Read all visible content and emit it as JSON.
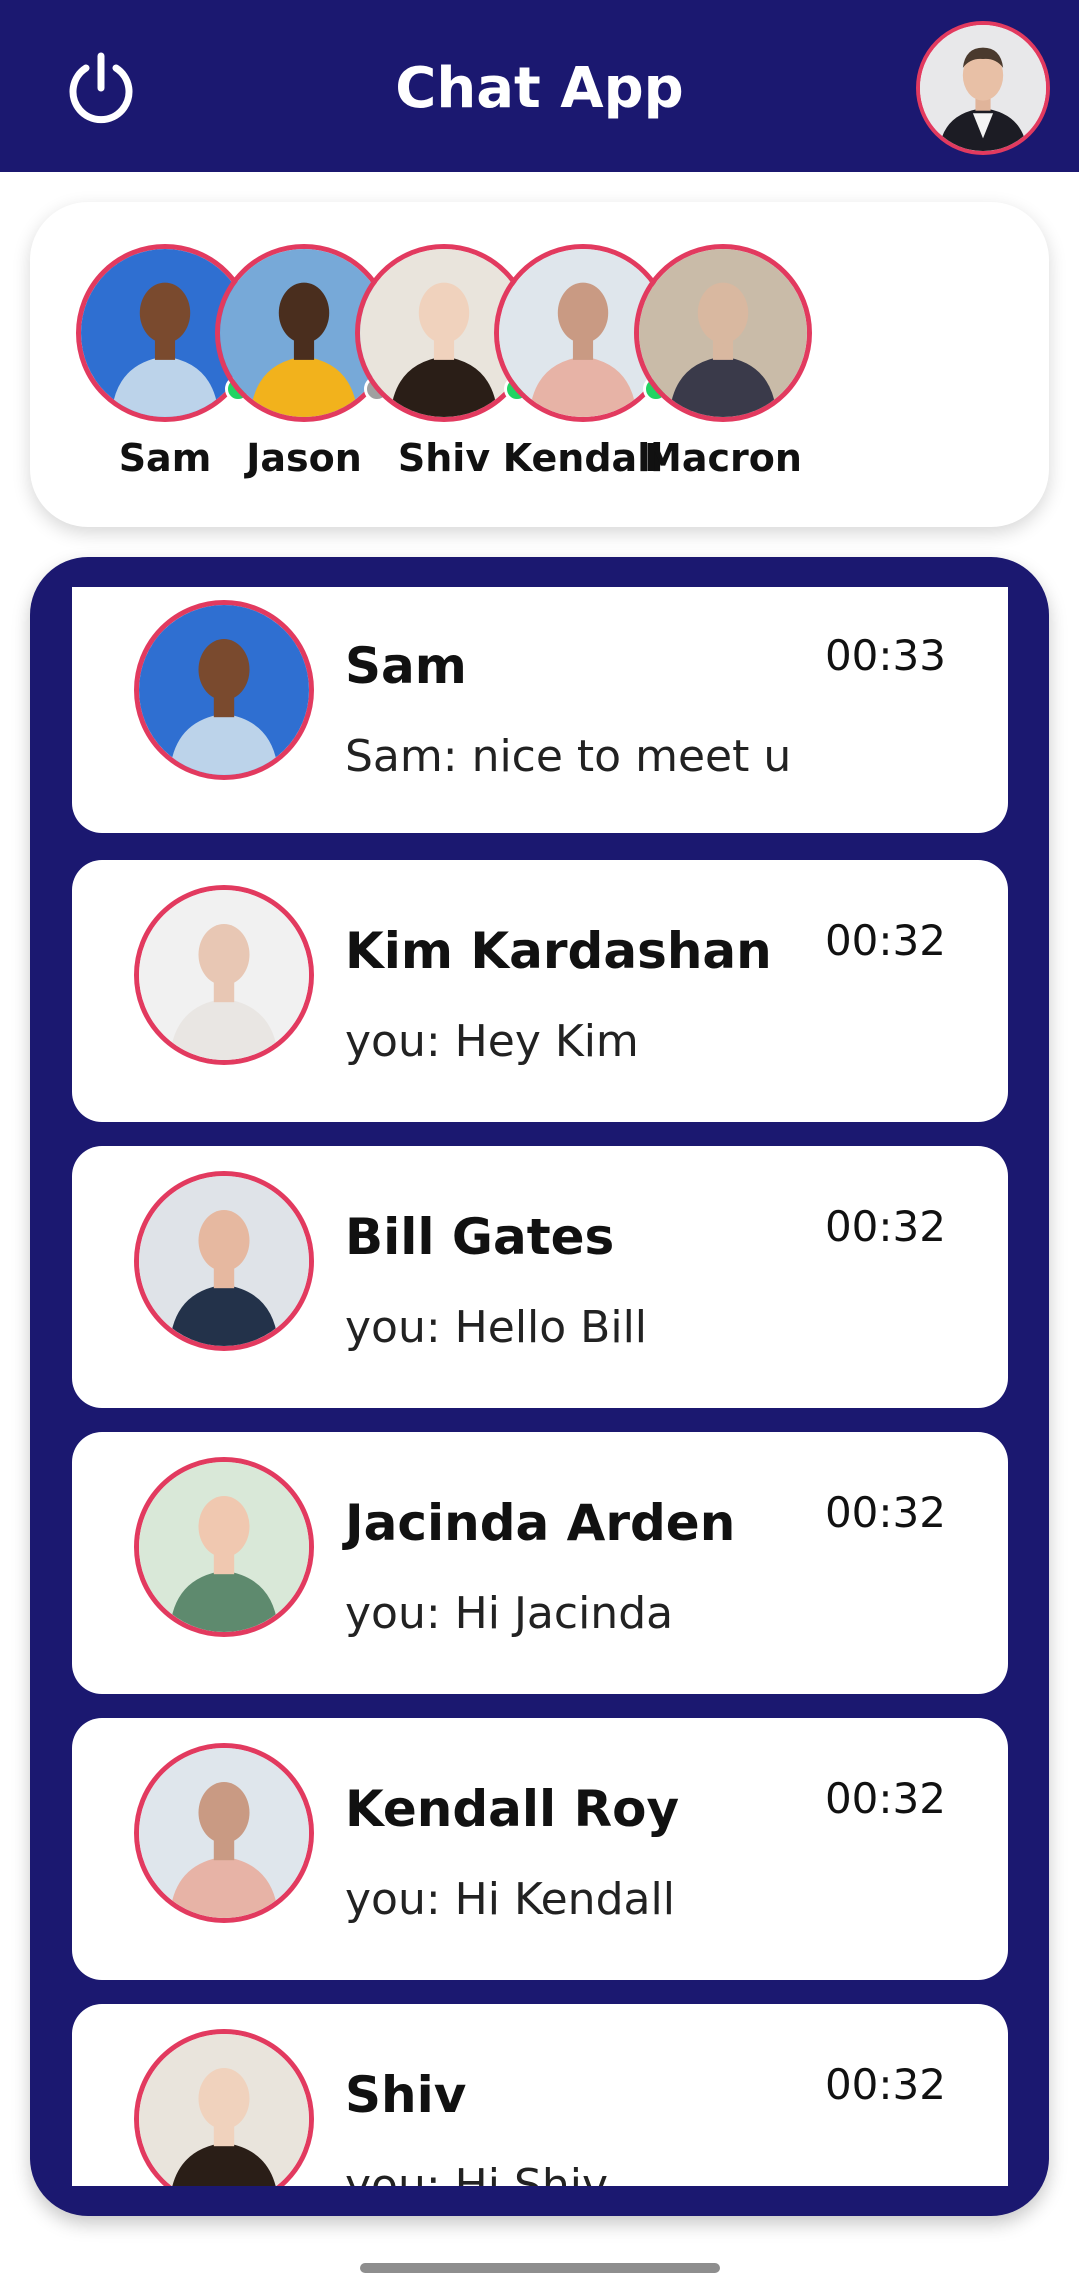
{
  "app": {
    "title": "Chat App"
  },
  "colors": {
    "brand": "#1b1870",
    "accent": "#e23a5f",
    "online": "#22d463",
    "offline": "#a0a0a0"
  },
  "header": {
    "power_icon": "power-icon",
    "profile_avatar": "current-user-avatar"
  },
  "stories": [
    {
      "name": "Sam",
      "status": "online",
      "bg": "#2f6fd1",
      "skin": "#7a4a2e",
      "shirt": "#bcd3ea"
    },
    {
      "name": "Jason",
      "status": "offline",
      "bg": "#77a9d8",
      "skin": "#4a2e1e",
      "shirt": "#f2b21c"
    },
    {
      "name": "Shiv",
      "status": "online",
      "bg": "#e9e4dc",
      "skin": "#f0d2bd",
      "shirt": "#2a1e17"
    },
    {
      "name": "Kendall",
      "status": "online",
      "bg": "#dfe6ec",
      "skin": "#c99a83",
      "shirt": "#e7b3a6"
    },
    {
      "name": "Macron",
      "status": "",
      "bg": "#c9bba8",
      "skin": "#d9b8a0",
      "shirt": "#3a3a4a"
    }
  ],
  "chats": [
    {
      "name": "Sam",
      "time": "00:33",
      "preview": "Sam: nice to meet u",
      "bg": "#2f6fd1",
      "skin": "#7a4a2e",
      "shirt": "#bcd3ea"
    },
    {
      "name": "Kim Kardashan",
      "time": "00:32",
      "preview": "you: Hey Kim",
      "bg": "#f1f1f1",
      "skin": "#e8c7b4",
      "shirt": "#e9e6e3"
    },
    {
      "name": "Bill Gates",
      "time": "00:32",
      "preview": "you: Hello Bill",
      "bg": "#dfe3e8",
      "skin": "#e6b8a0",
      "shirt": "#23324a"
    },
    {
      "name": "Jacinda Arden",
      "time": "00:32",
      "preview": "you: Hi Jacinda",
      "bg": "#d9e8d8",
      "skin": "#f0c8b0",
      "shirt": "#5e8a6e"
    },
    {
      "name": "Kendall Roy",
      "time": "00:32",
      "preview": "you: Hi Kendall",
      "bg": "#dfe6ec",
      "skin": "#c99a83",
      "shirt": "#e7b3a6"
    },
    {
      "name": "Shiv",
      "time": "00:32",
      "preview": "you: Hi Shiv",
      "bg": "#e9e4dc",
      "skin": "#f0d2bd",
      "shirt": "#2a1e17"
    }
  ]
}
